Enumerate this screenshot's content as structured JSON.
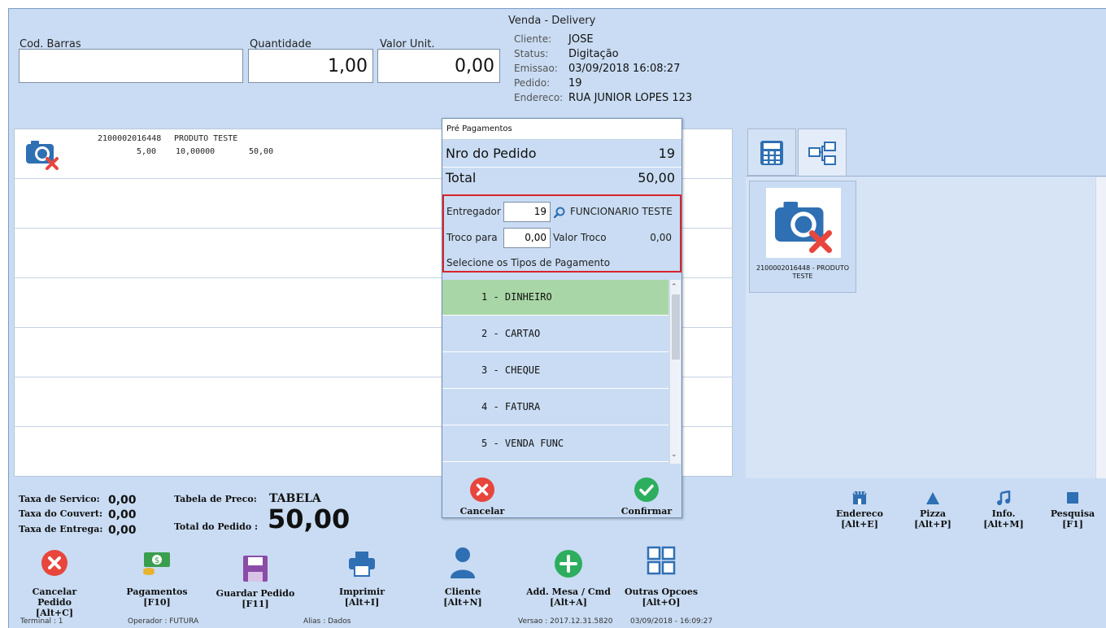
{
  "window": {
    "title": "Venda - Delivery"
  },
  "entry": {
    "barcode_label": "Cod. Barras",
    "barcode_value": "",
    "quantity_label": "Quantidade",
    "quantity_value": "1,00",
    "unit_value_label": "Valor Unit.",
    "unit_value": "0,00"
  },
  "order_info": {
    "cliente_label": "Cliente:",
    "cliente": "JOSE",
    "status_label": "Status:",
    "status": "Digitação",
    "emissao_label": "Emissao:",
    "emissao": "03/09/2018 16:08:27",
    "pedido_label": "Pedido:",
    "pedido": "19",
    "endereco_label": "Endereco:",
    "endereco": "RUA JUNIOR LOPES 123"
  },
  "items": [
    {
      "code": "2100002016448",
      "description": "PRODUTO TESTE",
      "qty": "5,00",
      "unit": "10,00000",
      "total": "50,00"
    }
  ],
  "right_tabs": [
    {
      "icon": "calculator-icon"
    },
    {
      "icon": "category-tree-icon"
    }
  ],
  "product_card": {
    "label": "2100002016448 - PRODUTO TESTE"
  },
  "totals": {
    "taxa_servico_label": "Taxa de Servico:",
    "taxa_servico": "0,00",
    "taxa_couvert_label": "Taxa do Couvert:",
    "taxa_couvert": "0,00",
    "taxa_entrega_label": "Taxa de Entrega:",
    "taxa_entrega": "0,00",
    "tabela_preco_label": "Tabela de Preco:",
    "tabela_preco": "TABELA",
    "total_pedido_label": "Total do Pedido :",
    "total_pedido": "50,00"
  },
  "dialog": {
    "title": "Pré Pagamentos",
    "nro_label": "Nro do Pedido",
    "nro": "19",
    "total_label": "Total",
    "total": "50,00",
    "entregador_label": "Entregador",
    "entregador_code": "19",
    "entregador_name": "FUNCIONARIO TESTE",
    "troco_label": "Troco para",
    "troco_value": "0,00",
    "valor_troco_label": "Valor Troco",
    "valor_troco": "0,00",
    "select_label": "Selecione os Tipos de Pagamento",
    "payment_types": [
      "1 - DINHEIRO",
      "2 - CARTAO",
      "3 - CHEQUE",
      "4 - FATURA",
      "5 - VENDA FUNC"
    ],
    "selected_index": 0,
    "cancel_label": "Cancelar",
    "confirm_label": "Confirmar"
  },
  "shortcuts": [
    {
      "label": "Endereco",
      "key": "[Alt+E]",
      "icon": "store-icon"
    },
    {
      "label": "Pizza",
      "key": "[Alt+P]",
      "icon": "pizza-icon"
    },
    {
      "label": "Info.",
      "key": "[Alt+M]",
      "icon": "music-note-icon"
    },
    {
      "label": "Pesquisa",
      "key": "[F1]",
      "icon": "search-square-icon"
    }
  ],
  "toolbar": [
    {
      "label": "Cancelar Pedido",
      "key": "[Alt+C]"
    },
    {
      "label": "Pagamentos",
      "key": "[F10]"
    },
    {
      "label": "Guardar Pedido",
      "key": "[F11]"
    },
    {
      "label": "Imprimir",
      "key": "[Alt+I]"
    },
    {
      "label": "Cliente",
      "key": "[Alt+N]"
    },
    {
      "label": "Add. Mesa / Cmd",
      "key": "[Alt+A]"
    },
    {
      "label": "Outras Opcoes",
      "key": "[Alt+O]"
    }
  ],
  "status_bar": {
    "terminal": "Terminal : 1",
    "operador": "Operador : FUTURA",
    "alias": "Alias : Dados",
    "versao": "Versao : 2017.12.31.5820",
    "datetime": "03/09/2018 - 16:09:27"
  },
  "colors": {
    "background": "#c9dcf3",
    "selected_payment": "#a9d6a6",
    "highlight_border": "#d9242b",
    "cancel_red": "#e8453c",
    "confirm_green": "#2dae5e"
  }
}
